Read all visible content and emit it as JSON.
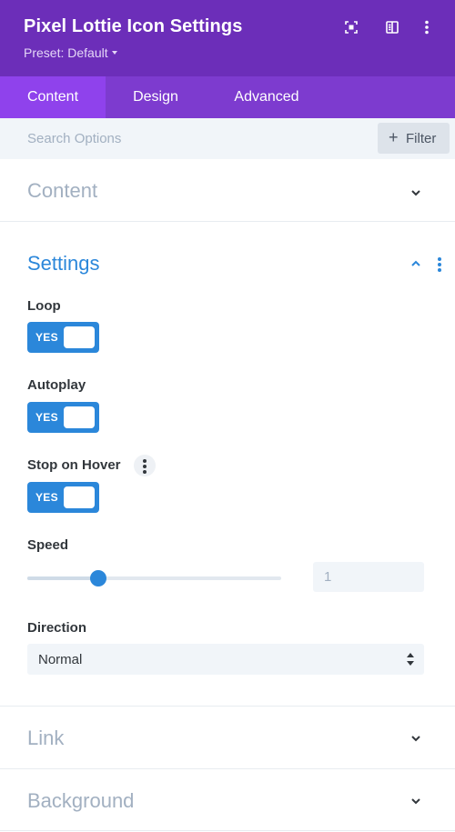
{
  "header": {
    "title": "Pixel Lottie Icon Settings",
    "preset_label": "Preset: Default",
    "icons": [
      "focus-icon",
      "split-view-icon",
      "more-vertical-icon"
    ],
    "background": "#6c2eb9"
  },
  "tabs": [
    {
      "label": "Content",
      "active": true
    },
    {
      "label": "Design",
      "active": false
    },
    {
      "label": "Advanced",
      "active": false
    }
  ],
  "search": {
    "placeholder": "Search Options",
    "value": "",
    "filter_label": "Filter"
  },
  "sections": {
    "content": {
      "title": "Content",
      "expanded": false
    },
    "settings": {
      "title": "Settings",
      "expanded": true
    },
    "link": {
      "title": "Link",
      "expanded": false
    },
    "background": {
      "title": "Background",
      "expanded": false
    }
  },
  "settings": {
    "loop": {
      "label": "Loop",
      "toggle_text": "YES",
      "on": true
    },
    "autoplay": {
      "label": "Autoplay",
      "toggle_text": "YES",
      "on": true
    },
    "stop_on_hover": {
      "label": "Stop on Hover",
      "toggle_text": "YES",
      "on": true
    },
    "speed": {
      "label": "Speed",
      "value": "1",
      "slider_fraction": 0.28
    },
    "direction": {
      "label": "Direction",
      "selected": "Normal"
    }
  },
  "colors": {
    "accent": "#2b87da",
    "header": "#6c2eb9",
    "tab_bar": "#7d3bcf",
    "tab_active": "#8f42ec",
    "muted_text": "#a2b0c1"
  }
}
